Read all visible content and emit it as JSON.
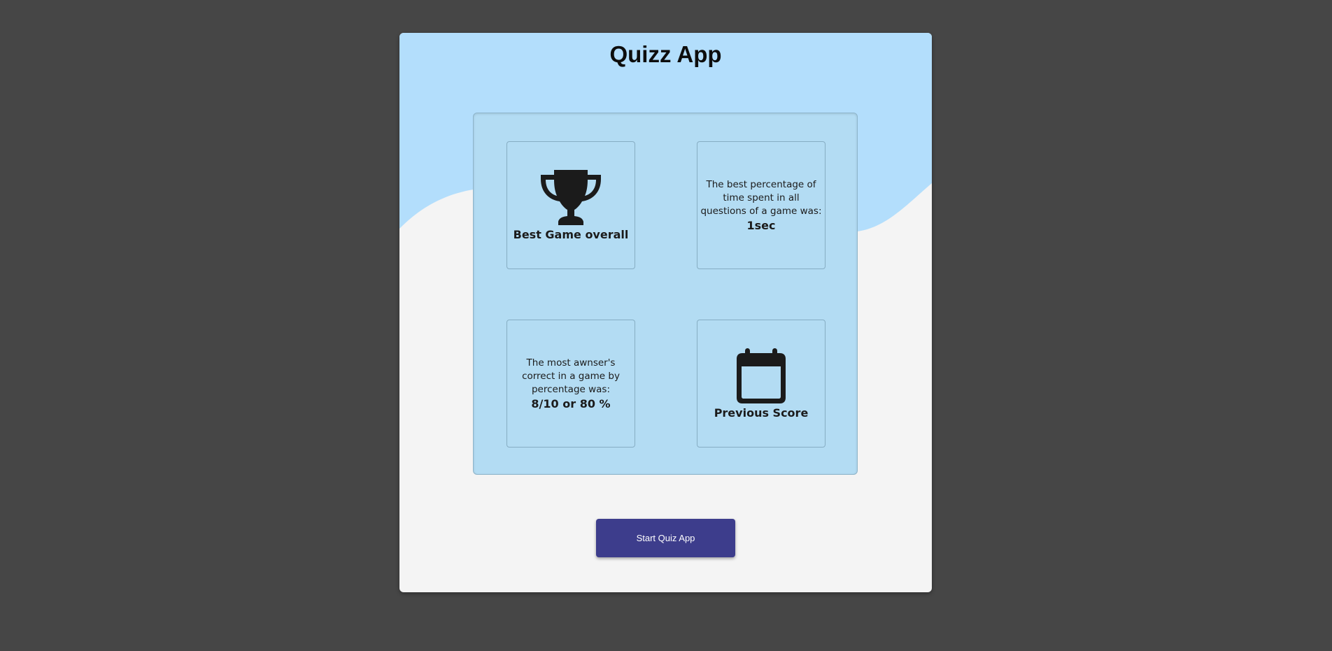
{
  "app": {
    "title": "Quizz App"
  },
  "stats": {
    "best_game": {
      "icon": "trophy-icon",
      "label": "Best Game overall"
    },
    "best_time": {
      "description": "The best percentage of time spent in all questions of a game was:",
      "value": "1sec"
    },
    "most_correct": {
      "description": "The most awnser's correct in a game by percentage was:",
      "value": "8/10 or 80 %"
    },
    "previous_score": {
      "icon": "calendar-icon",
      "label": "Previous Score"
    }
  },
  "actions": {
    "start_label": "Start Quiz App"
  },
  "colors": {
    "page_background": "#464646",
    "card_background": "#f4f4f4",
    "wave_blue": "#b3defc",
    "panel_blue": "#b3dcf3",
    "button_background": "#3d3d8c",
    "button_text": "#ffffff",
    "icon_color": "#1b1b1b"
  }
}
